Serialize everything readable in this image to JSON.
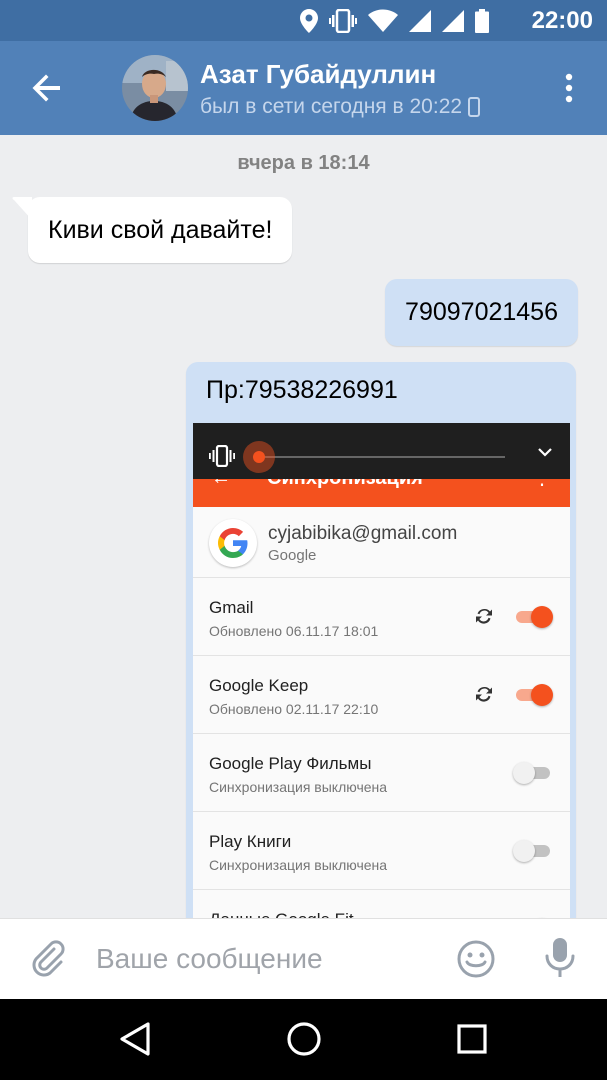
{
  "status_bar": {
    "time": "22:00",
    "icons": [
      "location-icon",
      "vibrate-icon",
      "wifi-icon",
      "signal-icon",
      "battery-icon"
    ]
  },
  "header": {
    "contact_name": "Азат Губайдуллин",
    "last_seen": "был в сети сегодня в 20:22",
    "icons": [
      "back-arrow-icon",
      "phone-icon",
      "more-vert-icon"
    ]
  },
  "chat": {
    "date_separator": "вчера в 18:14",
    "messages": [
      {
        "direction": "incoming",
        "text": "Киви свой давайте!"
      },
      {
        "direction": "outgoing",
        "text": "79097021456"
      },
      {
        "direction": "outgoing",
        "text": "Пр:79538226991",
        "has_image": true
      }
    ]
  },
  "attachment": {
    "screen_title": "Синхронизация",
    "account_email": "cyjabibika@gmail.com",
    "account_provider": "Google",
    "sync_items": [
      {
        "title": "Gmail",
        "subtitle": "Обновлено 06.11.17 18:01",
        "enabled": true,
        "show_sync": true
      },
      {
        "title": "Google Keep",
        "subtitle": "Обновлено 02.11.17 22:10",
        "enabled": true,
        "show_sync": true
      },
      {
        "title": "Google Play Фильмы",
        "subtitle": "Синхронизация выключена",
        "enabled": false,
        "show_sync": false
      },
      {
        "title": "Play Книги",
        "subtitle": "Синхронизация выключена",
        "enabled": false,
        "show_sync": false
      },
      {
        "title": "Данные Google Fit",
        "subtitle": "",
        "enabled": true,
        "show_sync": false
      }
    ],
    "volume_level": 0.0,
    "accent_color": "#f4511e"
  },
  "composer": {
    "placeholder": "Ваше сообщение",
    "icons": [
      "attach-icon",
      "emoji-icon",
      "mic-icon"
    ]
  },
  "nav_bar": {
    "icons": [
      "back-icon",
      "home-icon",
      "recents-icon"
    ]
  },
  "colors": {
    "header": "#5181b8",
    "status_bar": "#3f6ea3",
    "chat_background": "#edeef0",
    "outgoing_bubble": "#cfe0f5"
  }
}
